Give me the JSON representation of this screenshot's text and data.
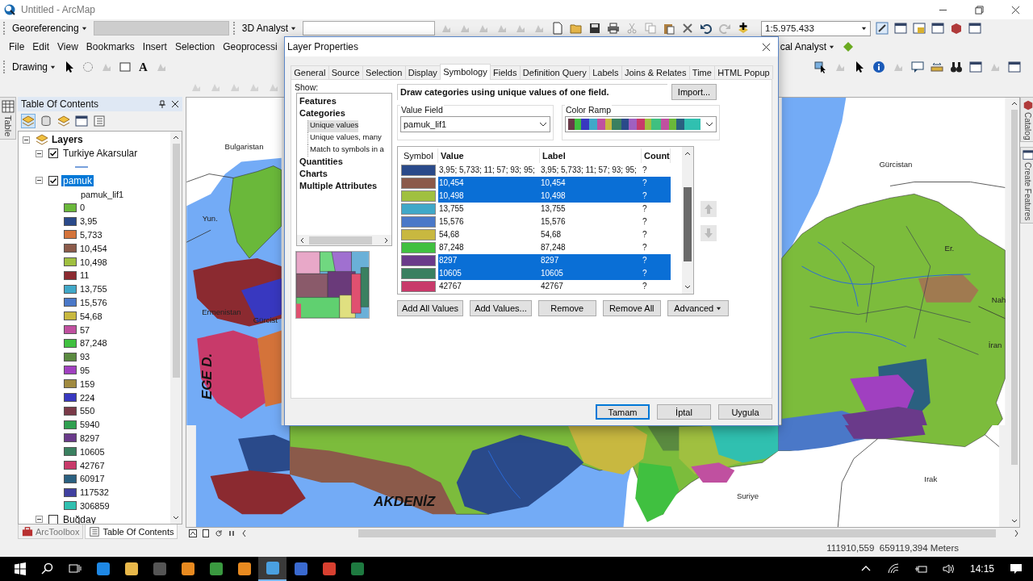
{
  "window": {
    "title": "Untitled - ArcMap"
  },
  "toolbar": {
    "georeferencing": "Georeferencing",
    "analyst_3d": "3D Analyst",
    "scale": "1:5.975.433"
  },
  "menu": [
    "File",
    "Edit",
    "View",
    "Bookmarks",
    "Insert",
    "Selection",
    "Geoprocessi"
  ],
  "spatial_analyst": "cal Analyst",
  "drawing_toolbar": {
    "label": "Drawing",
    "text_tool": "A"
  },
  "side_tab": "Table",
  "toc": {
    "title": "Table Of Contents",
    "root": {
      "label": "Layers",
      "expanded": true
    },
    "layers": [
      {
        "name": "Turkiye Akarsular",
        "kind": "line",
        "expanded": true,
        "checked": true,
        "selected": false
      },
      {
        "name": "pamuk",
        "kind": "polygons",
        "expanded": true,
        "checked": true,
        "selected": true,
        "field": "pamuk_lif1",
        "classes": [
          {
            "label": "0",
            "color": "#6ab83a"
          },
          {
            "label": "3,95",
            "color": "#2a4a8a"
          },
          {
            "label": "5,733",
            "color": "#d4733a"
          },
          {
            "label": "10,454",
            "color": "#8b5a4a"
          },
          {
            "label": "10,498",
            "color": "#a0c040"
          },
          {
            "label": "11",
            "color": "#8b2a30"
          },
          {
            "label": "13,755",
            "color": "#40a8c8"
          },
          {
            "label": "15,576",
            "color": "#4a78c8"
          },
          {
            "label": "54,68",
            "color": "#c8b840"
          },
          {
            "label": "57",
            "color": "#c050a0"
          },
          {
            "label": "87,248",
            "color": "#40c040"
          },
          {
            "label": "93",
            "color": "#5a8a40"
          },
          {
            "label": "95",
            "color": "#a040c0"
          },
          {
            "label": "159",
            "color": "#a08a40"
          },
          {
            "label": "224",
            "color": "#3838c0"
          },
          {
            "label": "550",
            "color": "#7a3a48"
          },
          {
            "label": "5940",
            "color": "#30a050"
          },
          {
            "label": "8297",
            "color": "#6a3a8a"
          },
          {
            "label": "10605",
            "color": "#3a8060"
          },
          {
            "label": "42767",
            "color": "#c83a6a"
          },
          {
            "label": "60917",
            "color": "#2a6080"
          },
          {
            "label": "117532",
            "color": "#4040a0"
          },
          {
            "label": "306859",
            "color": "#30c0b0"
          }
        ]
      },
      {
        "name": "Buğday",
        "kind": "polygons",
        "expanded": true,
        "checked": false,
        "selected": false
      }
    ],
    "tabs": [
      {
        "label": "ArcToolbox",
        "selected": false
      },
      {
        "label": "Table Of Contents",
        "selected": true
      }
    ]
  },
  "map": {
    "labels": [
      {
        "text": "Bulgaristan",
        "kind": "country"
      },
      {
        "text": "Gürcistan",
        "kind": "country"
      },
      {
        "text": "Yun.",
        "kind": "country"
      },
      {
        "text": "Er.",
        "kind": "country"
      },
      {
        "text": "Nah",
        "kind": "country"
      },
      {
        "text": "Ermenistan",
        "kind": "country"
      },
      {
        "text": "Gürcist",
        "kind": "country"
      },
      {
        "text": "İran",
        "kind": "country"
      },
      {
        "text": "EGE D.",
        "kind": "sea_vertical"
      },
      {
        "text": "Irak",
        "kind": "country"
      },
      {
        "text": "Suriye",
        "kind": "country"
      },
      {
        "text": "AKDENİZ",
        "kind": "sea"
      }
    ]
  },
  "right_tabs": [
    "Catalog",
    "Create Features"
  ],
  "dialog": {
    "title": "Layer Properties",
    "tabs": [
      {
        "label": "General",
        "selected": false
      },
      {
        "label": "Source",
        "selected": false
      },
      {
        "label": "Selection",
        "selected": false
      },
      {
        "label": "Display",
        "selected": false
      },
      {
        "label": "Symbology",
        "selected": true
      },
      {
        "label": "Fields",
        "selected": false
      },
      {
        "label": "Definition Query",
        "selected": false
      },
      {
        "label": "Labels",
        "selected": false
      },
      {
        "label": "Joins & Relates",
        "selected": false
      },
      {
        "label": "Time",
        "selected": false
      },
      {
        "label": "HTML Popup",
        "selected": false
      }
    ],
    "show_label": "Show:",
    "show_tree": [
      {
        "label": "Features",
        "selected": false
      },
      {
        "label": "Categories",
        "selected": false,
        "children": [
          {
            "label": "Unique values",
            "selected": true
          },
          {
            "label": "Unique values, many",
            "selected": false
          },
          {
            "label": "Match to symbols in a",
            "selected": false
          }
        ]
      },
      {
        "label": "Quantities",
        "selected": false
      },
      {
        "label": "Charts",
        "selected": false
      },
      {
        "label": "Multiple Attributes",
        "selected": false
      }
    ],
    "description": "Draw categories using unique values of one field.",
    "import_button": "Import...",
    "value_field": {
      "label": "Value Field",
      "value": "pamuk_lif1"
    },
    "color_ramp": {
      "label": "Color Ramp"
    },
    "table": {
      "columns": [
        "Symbol",
        "Value",
        "Label",
        "Count"
      ],
      "rows": [
        {
          "value": "3,95; 5,733; 11; 57; 93; 95;",
          "label": "3,95; 5,733; 11; 57; 93; 95;",
          "count": "?",
          "color": "#2a4a8a",
          "selected": false
        },
        {
          "value": "10,454",
          "label": "10,454",
          "count": "?",
          "color": "#8b5a4a",
          "selected": true
        },
        {
          "value": "10,498",
          "label": "10,498",
          "count": "?",
          "color": "#a0c040",
          "selected": true
        },
        {
          "value": "13,755",
          "label": "13,755",
          "count": "?",
          "color": "#40a8c8",
          "selected": false
        },
        {
          "value": "15,576",
          "label": "15,576",
          "count": "?",
          "color": "#4a78c8",
          "selected": false
        },
        {
          "value": "54,68",
          "label": "54,68",
          "count": "?",
          "color": "#c8b840",
          "selected": false
        },
        {
          "value": "87,248",
          "label": "87,248",
          "count": "?",
          "color": "#40c040",
          "selected": false
        },
        {
          "value": "8297",
          "label": "8297",
          "count": "?",
          "color": "#6a3a8a",
          "selected": true
        },
        {
          "value": "10605",
          "label": "10605",
          "count": "?",
          "color": "#3a8060",
          "selected": true
        },
        {
          "value": "42767",
          "label": "42767",
          "count": "?",
          "color": "#c83a6a",
          "selected": false
        }
      ]
    },
    "buttons": [
      {
        "label": "Add All Values",
        "kind": "plain"
      },
      {
        "label": "Add Values...",
        "kind": "plain"
      },
      {
        "label": "Remove",
        "kind": "plain"
      },
      {
        "label": "Remove All",
        "kind": "plain"
      },
      {
        "label": "Advanced",
        "kind": "menu"
      }
    ],
    "footer_buttons": [
      {
        "label": "Tamam",
        "default": true
      },
      {
        "label": "İptal",
        "default": false
      },
      {
        "label": "Uygula",
        "default": false
      }
    ]
  },
  "status_bar": {
    "coordinates": "111910,559  659119,394 Meters"
  },
  "taskbar": {
    "time": "14:15",
    "apps": [
      {
        "kind": "browser",
        "selected": false
      },
      {
        "kind": "folder",
        "selected": false
      },
      {
        "kind": "store",
        "selected": false
      },
      {
        "kind": "orange",
        "selected": false
      },
      {
        "kind": "globe",
        "selected": false
      },
      {
        "kind": "orange",
        "selected": false
      },
      {
        "kind": "arcmap",
        "selected": true
      },
      {
        "kind": "sphere",
        "selected": false
      },
      {
        "kind": "chrome",
        "selected": false
      },
      {
        "kind": "excel",
        "selected": false
      }
    ]
  }
}
